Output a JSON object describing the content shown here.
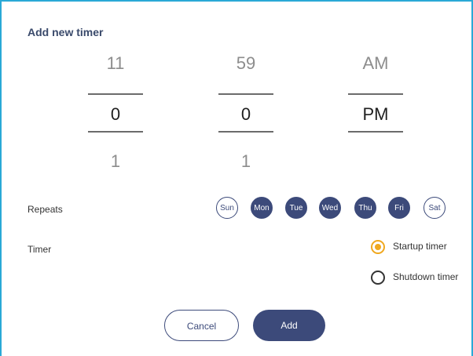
{
  "dialog": {
    "title": "Add new timer"
  },
  "picker": {
    "hour": {
      "prev": "11",
      "current": "0",
      "next": "1"
    },
    "minute": {
      "prev": "59",
      "current": "0",
      "next": "1"
    },
    "period": {
      "prev": "AM",
      "current": "PM"
    }
  },
  "repeats": {
    "label": "Repeats",
    "days": [
      {
        "label": "Sun",
        "selected": false
      },
      {
        "label": "Mon",
        "selected": true
      },
      {
        "label": "Tue",
        "selected": true
      },
      {
        "label": "Wed",
        "selected": true
      },
      {
        "label": "Thu",
        "selected": true
      },
      {
        "label": "Fri",
        "selected": true
      },
      {
        "label": "Sat",
        "selected": false
      }
    ]
  },
  "timer": {
    "label": "Timer",
    "options": [
      {
        "label": "Startup timer",
        "selected": true
      },
      {
        "label": "Shutdown timer",
        "selected": false
      }
    ]
  },
  "buttons": {
    "cancel": "Cancel",
    "add": "Add"
  },
  "colors": {
    "accent": "#3c4a7a",
    "radio_selected": "#f0a81f",
    "frame": "#2aa9d6"
  }
}
